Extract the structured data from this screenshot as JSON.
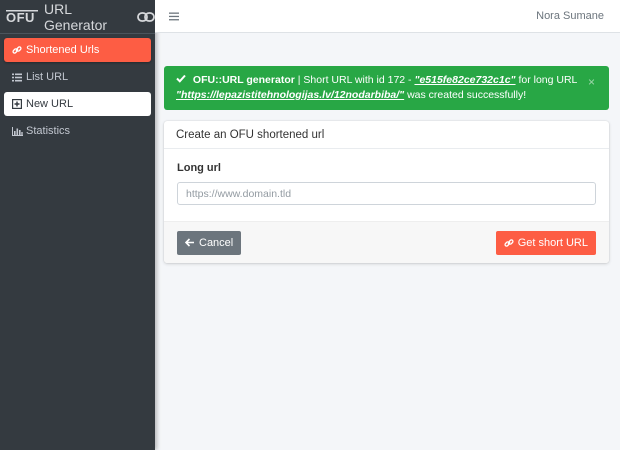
{
  "brand": {
    "logo_text": "OFU",
    "title": "URL Generator"
  },
  "sidebar": {
    "items": [
      {
        "label": "Shortened Urls",
        "icon": "link-icon"
      },
      {
        "label": "List URL",
        "icon": "list-icon"
      },
      {
        "label": "New URL",
        "icon": "plus-square-icon"
      },
      {
        "label": "Statistics",
        "icon": "bar-chart-icon"
      }
    ]
  },
  "header": {
    "user": "Nora Sumane"
  },
  "alert": {
    "prefix": "OFU::URL generator",
    "text1": " | Short URL with id 172 - ",
    "short_id": "\"e515fe82ce732c1c\"",
    "text2": " for long URL ",
    "long_url": "\"https://lepazistitehnologijas.lv/12nodarbiba/\"",
    "text3": " was created successfully!",
    "close": "×",
    "color": "#28a745"
  },
  "form": {
    "title": "Create an OFU shortened url",
    "long_url_label": "Long url",
    "long_url_placeholder": "https://www.domain.tld",
    "long_url_value": "",
    "cancel_label": "Cancel",
    "submit_label": "Get short URL"
  },
  "colors": {
    "accent": "#fd5d44",
    "sidebar_bg": "#343a40",
    "success": "#28a745",
    "secondary": "#6c757d"
  }
}
